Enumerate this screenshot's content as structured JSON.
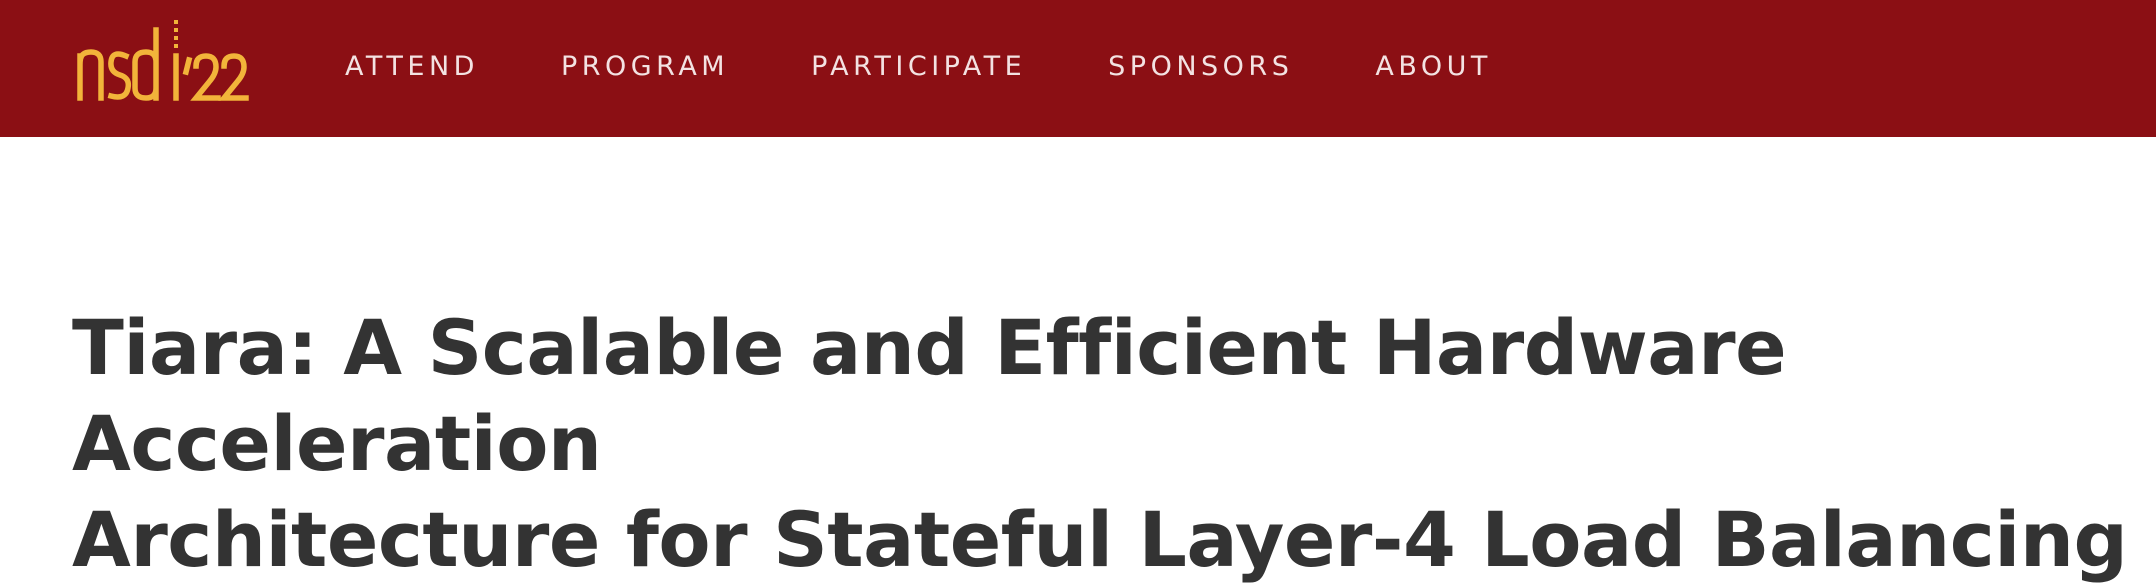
{
  "header": {
    "logo": {
      "text": "nsdi",
      "year": "'22",
      "color": "#f2b43a",
      "icon": "nsdi22-logo"
    },
    "nav": [
      {
        "label": "ATTEND"
      },
      {
        "label": "PROGRAM"
      },
      {
        "label": "PARTICIPATE"
      },
      {
        "label": "SPONSORS"
      },
      {
        "label": "ABOUT"
      }
    ],
    "background_color": "#8b0f14"
  },
  "main": {
    "title_line1": "Tiara: A Scalable and Efficient Hardware Acceleration",
    "title_line2": "Architecture for Stateful Layer-4 Load Balancing"
  }
}
